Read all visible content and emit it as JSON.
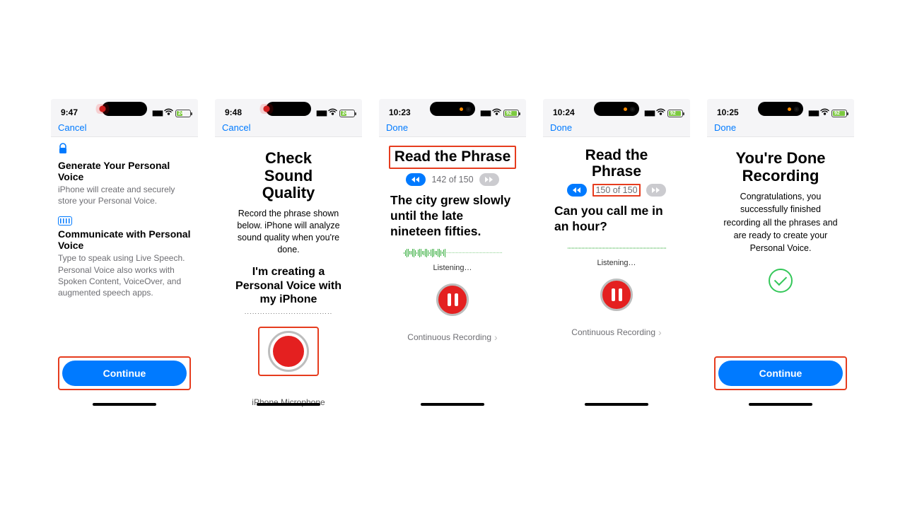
{
  "screens": [
    {
      "time": "9:47",
      "battery": "24",
      "nav": "Cancel",
      "section1": {
        "title": "Generate Your Personal Voice",
        "desc": "iPhone will create and securely store your Personal Voice."
      },
      "section2": {
        "title": "Communicate with Personal Voice",
        "desc": "Type to speak using Live Speech. Personal Voice also works with Spoken Content, VoiceOver, and augmented speech apps."
      },
      "cta": "Continue"
    },
    {
      "time": "9:48",
      "battery": "24",
      "nav": "Cancel",
      "title": "Check Sound Quality",
      "body": "Record the phrase shown below. iPhone will analyze sound quality when you're done.",
      "phrase": "I'm creating a Personal Voice with my iPhone",
      "mic_label": "iPhone Microphone"
    },
    {
      "time": "10:23",
      "battery": "92",
      "nav": "Done",
      "title": "Read the Phrase",
      "count": "142 of 150",
      "phrase": "The city grew slowly until the late nineteen fifties.",
      "listening": "Listening…",
      "footer": "Continuous Recording"
    },
    {
      "time": "10:24",
      "battery": "92",
      "nav": "Done",
      "title": "Read the Phrase",
      "count": "150 of 150",
      "phrase": "Can you call me in an hour?",
      "listening": "Listening…",
      "footer": "Continuous Recording"
    },
    {
      "time": "10:25",
      "battery": "92",
      "nav": "Done",
      "title": "You're Done Recording",
      "body": "Congratulations, you successfully finished recording all the phrases and are ready to create your Personal Voice.",
      "cta": "Continue"
    }
  ]
}
